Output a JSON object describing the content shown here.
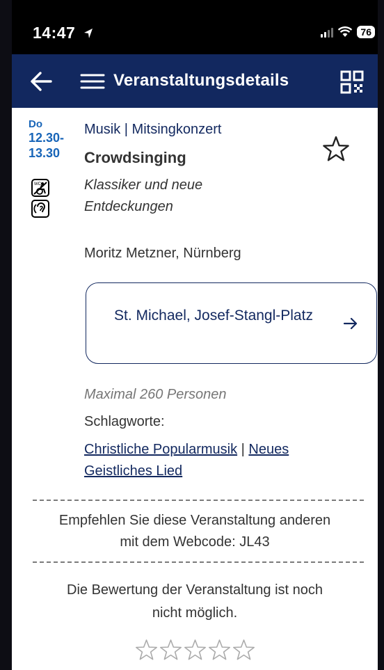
{
  "status_bar": {
    "time": "14:47",
    "battery": "76"
  },
  "header": {
    "title": "Veranstaltungsdetails"
  },
  "event": {
    "day": "Do",
    "time_start": "12.30-",
    "time_end": "13.30",
    "category": "Musik | Mitsingkonzert",
    "title": "Crowdsinging",
    "subtitle": "Klassiker und neue Entdeckungen",
    "performer": "Moritz Metzner, Nürnberg",
    "location": "St. Michael, Josef-Stangl-Platz",
    "capacity": "Maximal 260 Personen",
    "keywords_label": "Schlagworte:",
    "keywords": [
      "Christliche Popularmusik",
      "Neues Geistliches Lied"
    ],
    "keywords_separator": " | "
  },
  "recommend": {
    "line1": "Empfehlen Sie diese Veranstaltung anderen",
    "line2": "mit dem Webcode: JL43"
  },
  "rating": {
    "line1": "Die Bewertung der Veranstaltung ist noch",
    "line2": "nicht möglich.",
    "stars_total": 5,
    "stars_filled": 0
  },
  "icons": {
    "back": "arrow-left-icon",
    "menu": "hamburger-menu-icon",
    "qr": "qr-code-icon",
    "favorite": "star-outline-icon",
    "location_arrow": "arrow-right-icon",
    "wheelchair_wc": "wheelchair-wc-icon",
    "hearing_loop": "hearing-loop-icon"
  },
  "colors": {
    "header_bg": "#12285f",
    "accent_blue": "#1865b8",
    "link": "#12285f"
  }
}
